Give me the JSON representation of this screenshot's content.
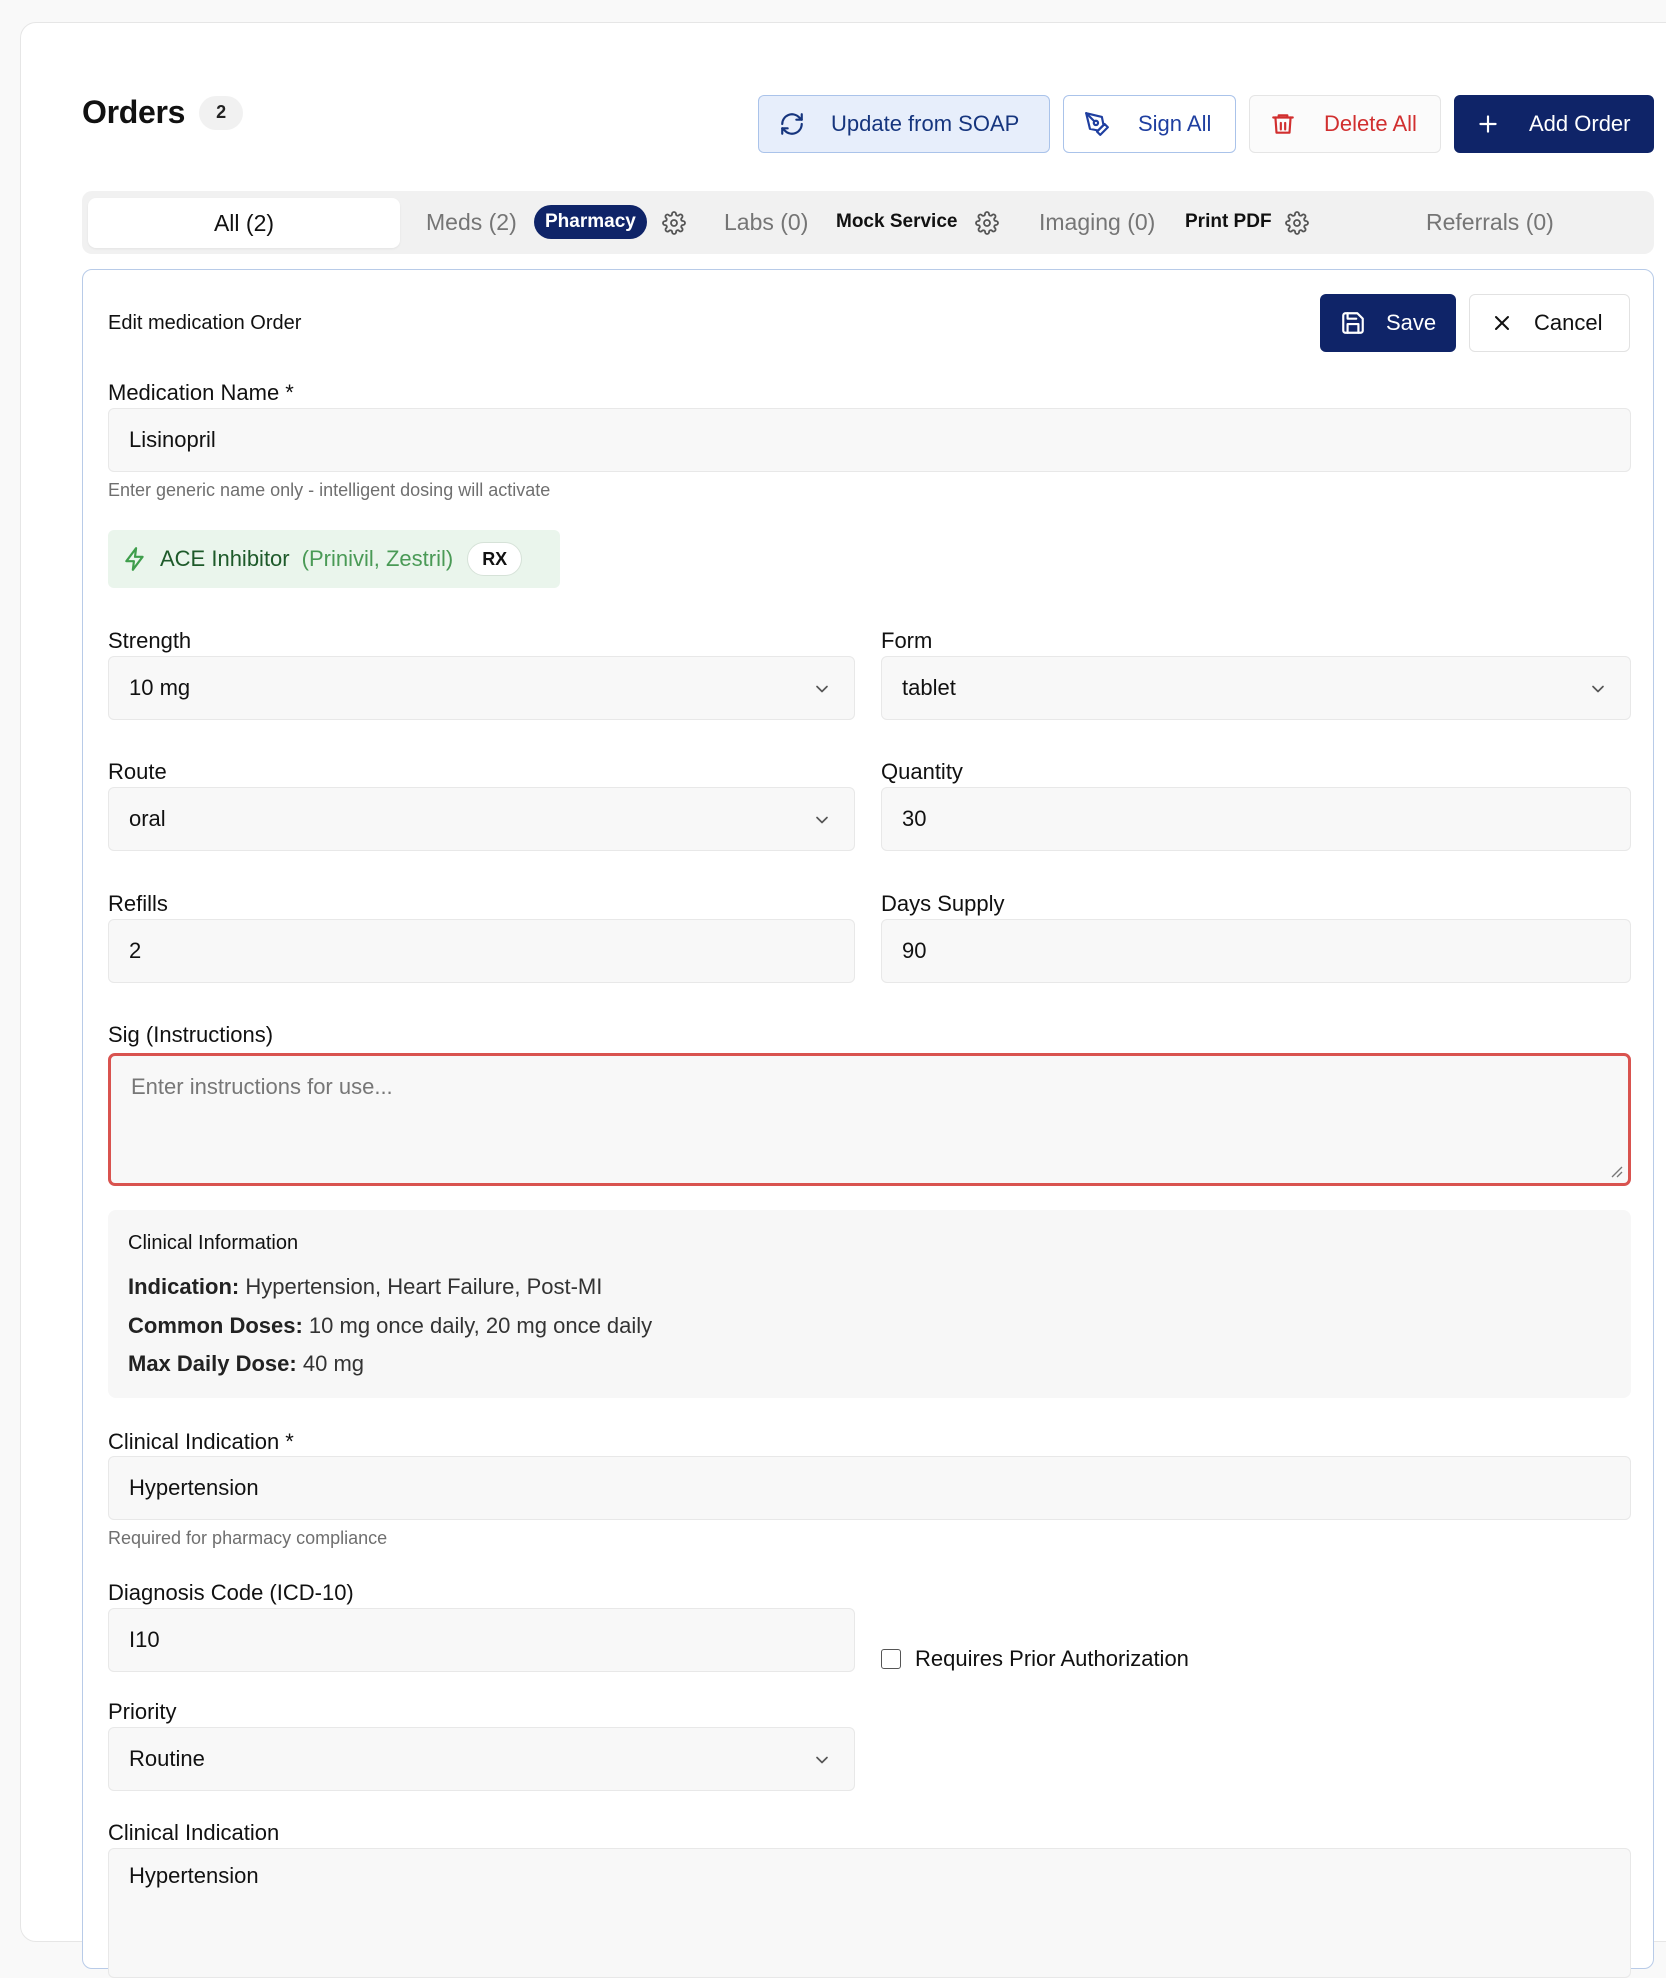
{
  "header": {
    "title": "Orders",
    "count": "2"
  },
  "toolbar": {
    "update_label": "Update from SOAP",
    "sign_label": "Sign All",
    "delete_label": "Delete All",
    "add_label": "Add Order"
  },
  "tabs": {
    "all": "All (2)",
    "meds": "Meds (2)",
    "pharmacy_badge": "Pharmacy",
    "labs": "Labs (0)",
    "mock_service": "Mock Service",
    "imaging": "Imaging (0)",
    "print_pdf": "Print PDF",
    "referrals": "Referrals (0)"
  },
  "form": {
    "title": "Edit medication Order",
    "save_label": "Save",
    "cancel_label": "Cancel",
    "medication_name": {
      "label": "Medication Name *",
      "value": "Lisinopril",
      "hint": "Enter generic name only - intelligent dosing will activate"
    },
    "drug_class": {
      "name": "ACE Inhibitor",
      "brands": "(Prinivil, Zestril)",
      "badge": "RX"
    },
    "strength": {
      "label": "Strength",
      "value": "10 mg"
    },
    "form_field": {
      "label": "Form",
      "value": "tablet"
    },
    "route": {
      "label": "Route",
      "value": "oral"
    },
    "quantity": {
      "label": "Quantity",
      "value": "30"
    },
    "refills": {
      "label": "Refills",
      "value": "2"
    },
    "days_supply": {
      "label": "Days Supply",
      "value": "90"
    },
    "sig": {
      "label": "Sig (Instructions)",
      "placeholder": "Enter instructions for use..."
    },
    "clinical_info": {
      "title": "Clinical Information",
      "indication_key": "Indication:",
      "indication_value": "Hypertension, Heart Failure, Post-MI",
      "doses_key": "Common Doses:",
      "doses_value": "10 mg once daily, 20 mg once daily",
      "max_key": "Max Daily Dose:",
      "max_value": "40 mg"
    },
    "clinical_indication": {
      "label": "Clinical Indication *",
      "value": "Hypertension",
      "hint": "Required for pharmacy compliance"
    },
    "diagnosis_code": {
      "label": "Diagnosis Code (ICD-10)",
      "value": "I10"
    },
    "prior_auth": {
      "label": "Requires Prior Authorization",
      "checked": false
    },
    "priority": {
      "label": "Priority",
      "value": "Routine"
    },
    "clinical_indication_2": {
      "label": "Clinical Indication",
      "value": "Hypertension"
    }
  },
  "colors": {
    "primary": "#0f2468",
    "danger": "#d12f2f",
    "success": "#3f9e4c",
    "error_border": "#d9534f"
  }
}
